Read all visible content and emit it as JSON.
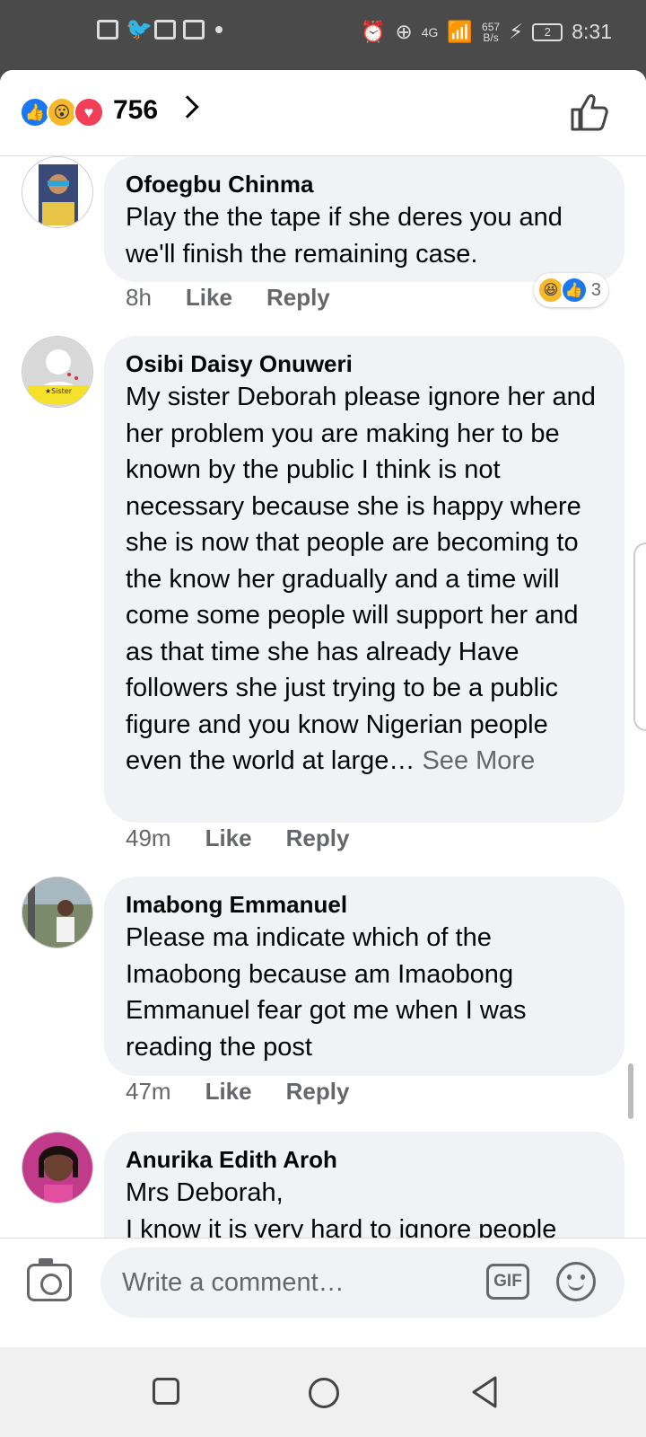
{
  "status_bar": {
    "time": "8:31",
    "network_speed": "657",
    "network_speed_unit": "B/s",
    "network_type": "4G",
    "battery_level": "2"
  },
  "reactions": {
    "count": "756",
    "icons": [
      "like",
      "wow",
      "love"
    ]
  },
  "comments": [
    {
      "author": "Ofoegbu Chinma",
      "text": "Play the the tape if she deres you and we'll finish the remaining case.",
      "time": "8h",
      "like_label": "Like",
      "reply_label": "Reply",
      "reaction_count": "3",
      "reaction_icons": [
        "haha",
        "like"
      ]
    },
    {
      "author": "Osibi Daisy Onuweri",
      "text": "My sister Deborah please ignore her and her problem you are making her to be known by the public I think is not necessary because she is happy where she is now that people are becoming to the know her gradually and a time will come some people will support her and as that time she has already Have followers she just trying to be a public figure and you know Nigerian people even the world at large…",
      "see_more": "See More",
      "time": "49m",
      "like_label": "Like",
      "reply_label": "Reply"
    },
    {
      "author": "Imabong Emmanuel",
      "text": "Please ma indicate which of the Imaobong because am Imaobong Emmanuel fear got me when I was reading the post",
      "time": "47m",
      "like_label": "Like",
      "reply_label": "Reply"
    },
    {
      "author": "Anurika Edith Aroh",
      "text": "Mrs Deborah,\nI know it is very hard to ignore people"
    }
  ],
  "composer": {
    "placeholder": "Write a comment…",
    "gif_label": "GIF"
  },
  "colors": {
    "facebook_blue": "#1877f2",
    "bubble_bg": "#f0f2f5",
    "secondary_text": "#65676b"
  }
}
